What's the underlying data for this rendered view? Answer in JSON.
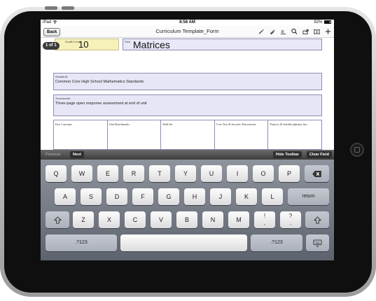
{
  "status_bar": {
    "carrier": "iPad",
    "wifi_icon": "wifi-icon",
    "time": "8:58 AM",
    "battery": "92%",
    "battery_level": 0.92
  },
  "nav": {
    "back_label": "Back",
    "title": "Curriculum Template_Form",
    "tools": [
      "pen-icon",
      "eraser-icon",
      "text-icon",
      "search-icon",
      "share-icon",
      "bookmarks-icon",
      "add-icon"
    ]
  },
  "document": {
    "page_badge": "1 of 1",
    "grade_label": "Grade Level",
    "grade_value": "10",
    "unit_label": "Unit",
    "unit_value": "Matrices",
    "standards_label": "Standards",
    "standards_value": "Common Core High School Mathematics Standards",
    "assessment_label": "Assessment",
    "assessment_value": "Three-page open response assessment at end of unit",
    "columns": [
      "Key Concepts",
      "Unit Benchmarks",
      "Skill Set",
      "Core Text & Socratic Discussions",
      "Projects & Interdisciplinary ties"
    ]
  },
  "form_toolbar": {
    "previous": "Previous",
    "next": "Next",
    "hide": "Hide Toolbar",
    "clear": "Clear Field"
  },
  "keyboard": {
    "row1": [
      "Q",
      "W",
      "E",
      "R",
      "T",
      "Y",
      "U",
      "I",
      "O",
      "P"
    ],
    "delete_icon": "backspace-icon",
    "row2": [
      "A",
      "S",
      "D",
      "F",
      "G",
      "H",
      "J",
      "K",
      "L"
    ],
    "return": "return",
    "shift_icon": "shift-icon",
    "row3": [
      "Z",
      "X",
      "C",
      "V",
      "B",
      "N",
      "M"
    ],
    "punct1": [
      "!",
      ","
    ],
    "punct2": [
      "?",
      "."
    ],
    "numbers": ".?123",
    "hide_keyboard_icon": "keyboard-hide-icon"
  }
}
